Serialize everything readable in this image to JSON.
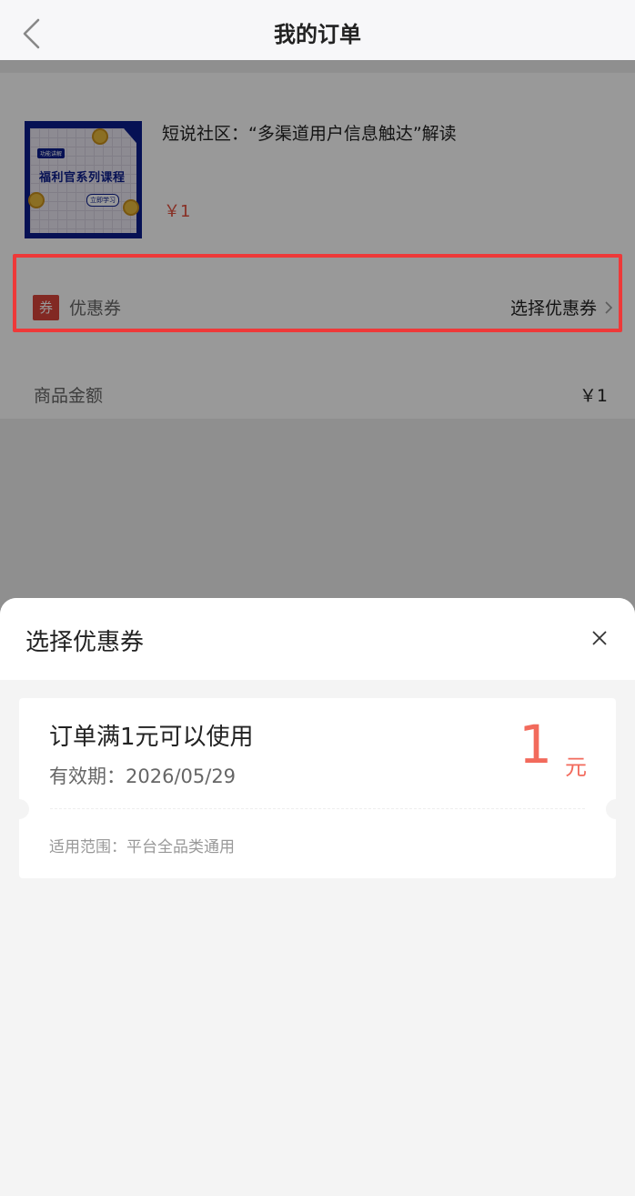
{
  "header": {
    "title": "我的订单"
  },
  "product": {
    "thumbnail": {
      "tag": "功能讲解",
      "title": "福利官系列课程",
      "button": "立即学习"
    },
    "name": "短说社区：“多渠道用户信息触达”解读",
    "price": "￥1"
  },
  "coupon_row": {
    "badge": "券",
    "label": "优惠券",
    "action": "选择优惠券"
  },
  "amount_row": {
    "label": "商品金额",
    "value": "￥1"
  },
  "sheet": {
    "title": "选择优惠券",
    "coupons": [
      {
        "condition": "订单满1元可以使用",
        "expiry": "有效期：2026/05/29",
        "amount": "1",
        "unit": "元",
        "scope": "适用范围：平台全品类通用"
      }
    ]
  },
  "colors": {
    "accent": "#f26a5c",
    "price": "#e3503e",
    "highlight": "#ee3939",
    "badge": "#d9453b"
  },
  "icons": [
    "back-arrow-icon",
    "chevron-right-icon",
    "close-icon"
  ]
}
